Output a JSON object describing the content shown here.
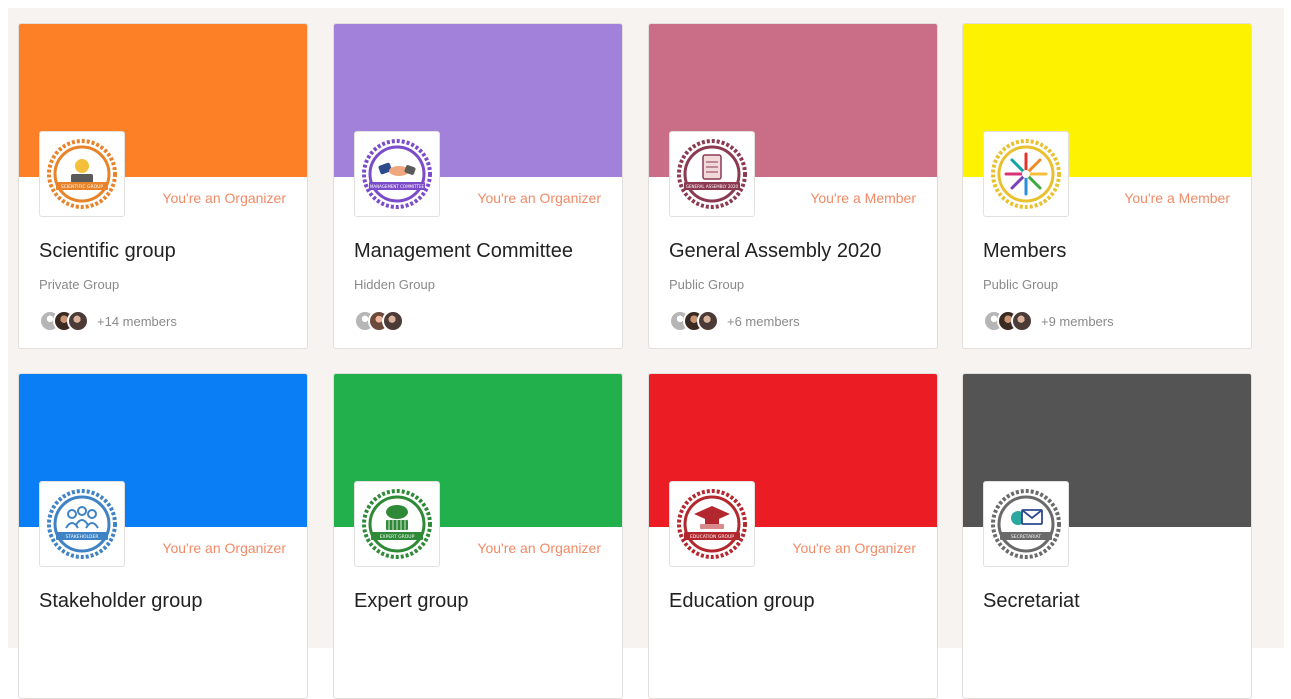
{
  "groups": [
    {
      "name": "Scientific group",
      "role": "You're an Organizer",
      "privacy": "Private Group",
      "members_extra": "+14 members",
      "cover_color": "#fd8027",
      "badge_color": "#e8832a",
      "badge_text": "SCIENTIFIC GROUP",
      "icon": "scientist-icon"
    },
    {
      "name": "Management Committee",
      "role": "You're an Organizer",
      "privacy": "Hidden Group",
      "members_extra": "",
      "cover_color": "#a181da",
      "badge_color": "#7b4cc9",
      "badge_text": "MANAGEMENT COMMITTEE",
      "icon": "handshake-icon"
    },
    {
      "name": "General Assembly 2020",
      "role": "You're a Member",
      "privacy": "Public Group",
      "members_extra": "+6 members",
      "cover_color": "#c96e86",
      "badge_color": "#8c3a52",
      "badge_text": "GENERAL ASSEMBLY 2020",
      "icon": "document-icon"
    },
    {
      "name": "Members",
      "role": "You're a Member",
      "privacy": "Public Group",
      "members_extra": "+9 members",
      "cover_color": "#fdf200",
      "badge_color": "#e9c130",
      "badge_text": "",
      "icon": "people-circle-icon"
    },
    {
      "name": "Stakeholder group",
      "role": "You're an Organizer",
      "privacy": "",
      "members_extra": "",
      "cover_color": "#0a7ef5",
      "badge_color": "#3f83c4",
      "badge_text": "STAKEHOLDER",
      "icon": "people-icon"
    },
    {
      "name": "Expert group",
      "role": "You're an Organizer",
      "privacy": "",
      "members_extra": "",
      "cover_color": "#22b04d",
      "badge_color": "#2e8a36",
      "badge_text": "EXPERT GROUP",
      "icon": "brain-icon"
    },
    {
      "name": "Education group",
      "role": "You're an Organizer",
      "privacy": "",
      "members_extra": "",
      "cover_color": "#ec1c24",
      "badge_color": "#b3282e",
      "badge_text": "EDUCATION GROUP",
      "icon": "graduation-cap-icon"
    },
    {
      "name": "Secretariat",
      "role": "",
      "privacy": "",
      "members_extra": "",
      "cover_color": "#545454",
      "badge_color": "#6a6a6a",
      "badge_text": "SECRETARIAT",
      "icon": "envelope-icon"
    }
  ]
}
